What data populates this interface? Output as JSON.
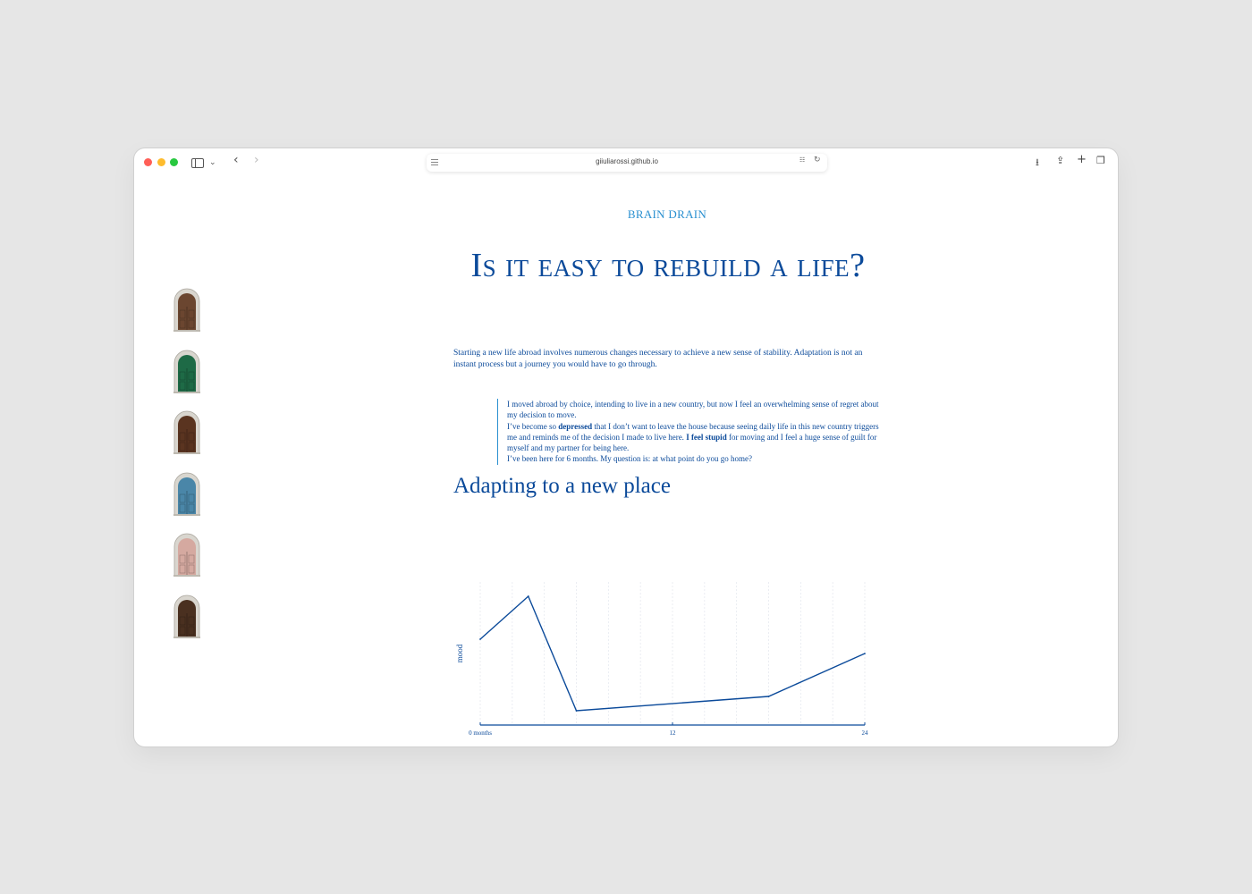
{
  "browser": {
    "url": "giiuliarossi.github.io"
  },
  "sidebar": {
    "doors": [
      {
        "icon": "door-arched-wood-icon",
        "color": "#6b4630"
      },
      {
        "icon": "door-arched-green-icon",
        "color": "#1e6a46"
      },
      {
        "icon": "door-arched-brown-icon",
        "color": "#5a3420"
      },
      {
        "icon": "door-arched-blue-icon",
        "color": "#4a86a8"
      },
      {
        "icon": "door-arched-pink-icon",
        "color": "#d5a9a0"
      },
      {
        "icon": "door-arched-dark-icon",
        "color": "#4a3020"
      }
    ]
  },
  "article": {
    "kicker": "BRAIN DRAIN",
    "title": "Is it easy to rebuild a life?",
    "intro": "Starting a new life abroad involves numerous changes necessary to achieve a new sense of stability. Adaptation is not an instant process but a journey you would have to go through.",
    "quote": {
      "line1": "I moved abroad by choice, intending to live in a new country, but now I feel an overwhelming sense of regret about my decision to move.",
      "line2_a": "I’ve become so ",
      "line2_b": "depressed",
      "line2_c": " that I don’t want to leave the house because seeing daily life in this new country triggers me and reminds me of the decision I made to live here. ",
      "line2_d": "I feel stupid",
      "line2_e": " for moving and I feel a huge sense of guilt for myself and my partner for being here.",
      "line3": "I’ve been here for 6 months. My question is: at what point do you go home?"
    },
    "section_title": "Adapting to a new place"
  },
  "colors": {
    "accent_dark": "#0b4a9a",
    "accent_light": "#2a90d0"
  },
  "chart_data": {
    "type": "line",
    "ylabel": "mood",
    "xlabel": "",
    "xlim": [
      0,
      24
    ],
    "ylim": [
      0,
      10
    ],
    "x_ticks": [
      "0 months",
      "12",
      "24"
    ],
    "x": [
      0,
      3,
      6,
      18,
      24
    ],
    "values": [
      6.0,
      9.0,
      1.0,
      2.0,
      5.0
    ]
  }
}
